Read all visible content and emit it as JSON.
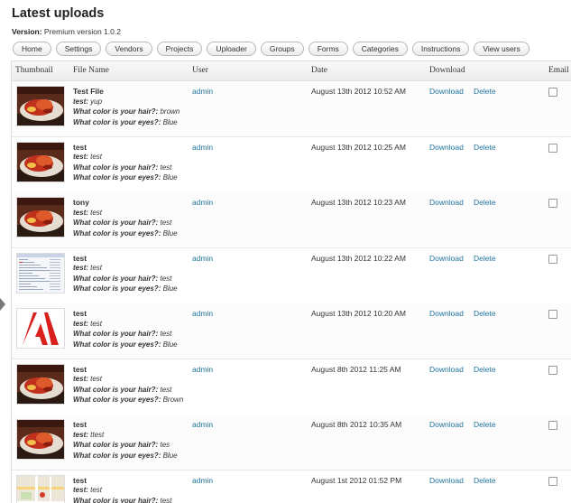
{
  "page": {
    "title": "Latest uploads",
    "version_label": "Version:",
    "version_value": "Premium version 1.0.2"
  },
  "nav": [
    "Home",
    "Settings",
    "Vendors",
    "Projects",
    "Uploader",
    "Groups",
    "Forms",
    "Categories",
    "Instructions",
    "View users"
  ],
  "table": {
    "columns": [
      "Thumbnail",
      "File Name",
      "User",
      "Date",
      "Download",
      "Email"
    ],
    "rows": [
      {
        "thumb": "food-photo",
        "file_name": "Test File",
        "user": "admin",
        "date": "August 13th 2012 10:52 AM",
        "download": "Download",
        "delete": "Delete",
        "fields": [
          {
            "label": "test:",
            "value": "yup"
          },
          {
            "label": "What color is your hair?:",
            "value": "brown"
          },
          {
            "label": "What color is your eyes?:",
            "value": "Blue"
          }
        ]
      },
      {
        "thumb": "food-photo",
        "file_name": "test",
        "user": "admin",
        "date": "August 13th 2012 10:25 AM",
        "download": "Download",
        "delete": "Delete",
        "fields": [
          {
            "label": "test:",
            "value": "test"
          },
          {
            "label": "What color is your hair?:",
            "value": "test"
          },
          {
            "label": "What color is your eyes?:",
            "value": "Blue"
          }
        ]
      },
      {
        "thumb": "food-photo",
        "file_name": "tony",
        "user": "admin",
        "date": "August 13th 2012 10:23 AM",
        "download": "Download",
        "delete": "Delete",
        "fields": [
          {
            "label": "test:",
            "value": "test"
          },
          {
            "label": "What color is your hair?:",
            "value": "test"
          },
          {
            "label": "What color is your eyes?:",
            "value": "Blue"
          }
        ]
      },
      {
        "thumb": "spreadsheet-screenshot",
        "file_name": "test",
        "user": "admin",
        "date": "August 13th 2012 10:22 AM",
        "download": "Download",
        "delete": "Delete",
        "fields": [
          {
            "label": "test:",
            "value": "test"
          },
          {
            "label": "What color is your hair?:",
            "value": "test"
          },
          {
            "label": "What color is your eyes?:",
            "value": "Blue"
          }
        ]
      },
      {
        "thumb": "adobe-pdf-logo",
        "file_name": "test",
        "user": "admin",
        "date": "August 13th 2012 10:20 AM",
        "download": "Download",
        "delete": "Delete",
        "fields": [
          {
            "label": "test:",
            "value": "test"
          },
          {
            "label": "What color is your hair?:",
            "value": "test"
          },
          {
            "label": "What color is your eyes?:",
            "value": "Blue"
          }
        ]
      },
      {
        "thumb": "food-photo",
        "file_name": "test",
        "user": "admin",
        "date": "August 8th 2012 11:25 AM",
        "download": "Download",
        "delete": "Delete",
        "fields": [
          {
            "label": "test:",
            "value": "test"
          },
          {
            "label": "What color is your hair?:",
            "value": "test"
          },
          {
            "label": "What color is your eyes?:",
            "value": "Brown"
          }
        ]
      },
      {
        "thumb": "food-photo",
        "file_name": "test",
        "user": "admin",
        "date": "August 8th 2012 10:35 AM",
        "download": "Download",
        "delete": "Delete",
        "fields": [
          {
            "label": "test:",
            "value": "ttest"
          },
          {
            "label": "What color is your hair?:",
            "value": "tes"
          },
          {
            "label": "What color is your eyes?:",
            "value": "Blue"
          }
        ]
      },
      {
        "thumb": "map-screenshot",
        "file_name": "test",
        "user": "admin",
        "date": "August 1st 2012 01:52 PM",
        "download": "Download",
        "delete": "Delete",
        "fields": [
          {
            "label": "test:",
            "value": "test"
          },
          {
            "label": "What color is your hair?:",
            "value": "test"
          }
        ]
      }
    ]
  }
}
